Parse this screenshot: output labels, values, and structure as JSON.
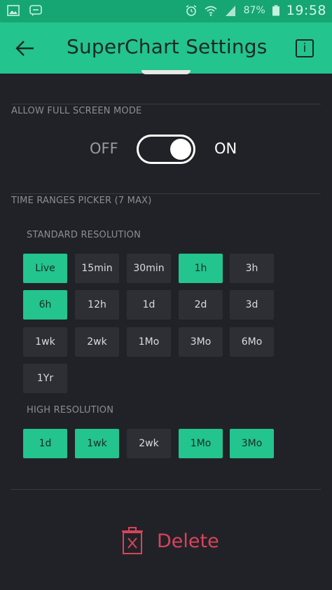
{
  "status_bar": {
    "battery": "87%",
    "time": "19:58",
    "icons": [
      "photo-icon",
      "chat-icon",
      "alarm-icon",
      "wifi-icon",
      "signal-icon",
      "battery-icon"
    ]
  },
  "header": {
    "title": "SuperChart Settings",
    "back_icon": "arrow-left-icon",
    "info_label": "i"
  },
  "fullscreen": {
    "section_label": "ALLOW FULL SCREEN MODE",
    "off_label": "OFF",
    "on_label": "ON",
    "enabled": true
  },
  "time_ranges": {
    "section_label": "TIME RANGES PICKER (7 MAX)",
    "standard_label": "STANDARD RESOLUTION",
    "standard": [
      {
        "label": "Live",
        "selected": true
      },
      {
        "label": "15min",
        "selected": false
      },
      {
        "label": "30min",
        "selected": false
      },
      {
        "label": "1h",
        "selected": true
      },
      {
        "label": "3h",
        "selected": false
      },
      {
        "label": "6h",
        "selected": true
      },
      {
        "label": "12h",
        "selected": false
      },
      {
        "label": "1d",
        "selected": false
      },
      {
        "label": "2d",
        "selected": false
      },
      {
        "label": "3d",
        "selected": false
      },
      {
        "label": "1wk",
        "selected": false
      },
      {
        "label": "2wk",
        "selected": false
      },
      {
        "label": "1Mo",
        "selected": false
      },
      {
        "label": "3Mo",
        "selected": false
      },
      {
        "label": "6Mo",
        "selected": false
      },
      {
        "label": "1Yr",
        "selected": false
      }
    ],
    "high_label": "HIGH RESOLUTION",
    "high": [
      {
        "label": "1d",
        "selected": true
      },
      {
        "label": "1wk",
        "selected": true
      },
      {
        "label": "2wk",
        "selected": false
      },
      {
        "label": "1Mo",
        "selected": true
      },
      {
        "label": "3Mo",
        "selected": true
      }
    ]
  },
  "delete": {
    "label": "Delete",
    "icon": "trash-icon"
  },
  "colors": {
    "accent": "#23c48e",
    "danger": "#d9435b",
    "background": "#212227"
  }
}
